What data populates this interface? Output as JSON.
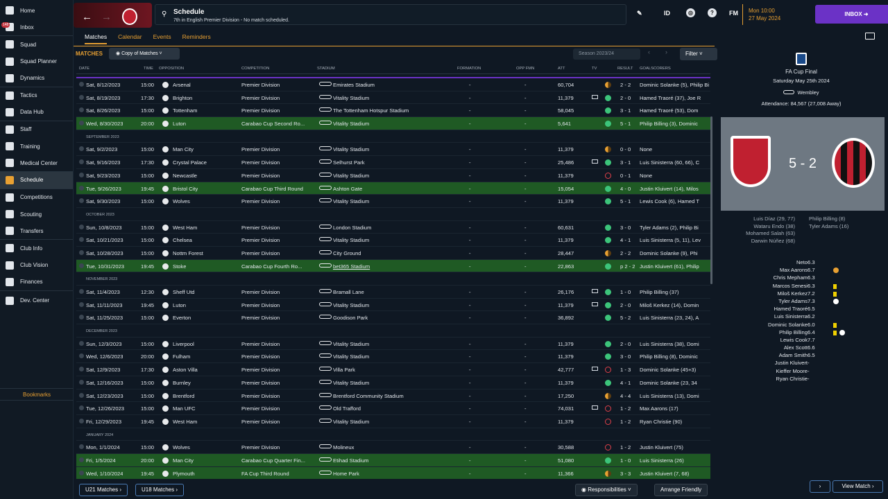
{
  "sidebar": {
    "inbox_badge": "148",
    "items": [
      "Home",
      "Inbox",
      "Squad",
      "Squad Planner",
      "Dynamics",
      "Tactics",
      "Data Hub",
      "Staff",
      "Training",
      "Medical Center",
      "Schedule",
      "Competitions",
      "Scouting",
      "Transfers",
      "Club Info",
      "Club Vision",
      "Finances",
      "Dev. Center"
    ],
    "bookmarks": "Bookmarks"
  },
  "header": {
    "title": "Schedule",
    "subtitle": "7th in English Premier Division - No match scheduled.",
    "id_label": "ID",
    "fm_label": "FM",
    "help": "?",
    "time": "Mon 10:00",
    "date": "27 May 2024",
    "inbox_label": "INBOX"
  },
  "subtabs": [
    "Matches",
    "Calendar",
    "Events",
    "Reminders"
  ],
  "toolbar": {
    "section": "MATCHES",
    "view": "Copy of Matches",
    "season": "Season 2023/24",
    "filter": "Filter"
  },
  "columns": [
    "DATE",
    "TIME",
    "OPPOSITION",
    "COMPETITION",
    "STADIUM",
    "FORMATION",
    "OPP FMN",
    "ATT",
    "TV",
    "RESULT",
    "GOALSCORERS"
  ],
  "rows": [
    {
      "date": "Sat, 8/12/2023",
      "time": "15:00",
      "opp": "Arsenal",
      "comp": "Premier Division",
      "stadium": "Emirates Stadium",
      "fmn": "-",
      "oppfmn": "-",
      "att": "60,704",
      "tv": false,
      "res": "D",
      "score": "2 - 2",
      "scorers": "Dominic Solanke (5), Philip Bi",
      "cup": false
    },
    {
      "date": "Sat, 8/19/2023",
      "time": "17:30",
      "opp": "Brighton",
      "comp": "Premier Division",
      "stadium": "Vitality Stadium",
      "fmn": "-",
      "oppfmn": "-",
      "att": "11,379",
      "tv": true,
      "res": "W",
      "score": "2 - 0",
      "scorers": "Hamed Traoré (37), Joe R",
      "cup": false
    },
    {
      "date": "Sat, 8/26/2023",
      "time": "15:00",
      "opp": "Tottenham",
      "comp": "Premier Division",
      "stadium": "The Tottenham Hotspur Stadium",
      "fmn": "-",
      "oppfmn": "-",
      "att": "58,045",
      "tv": false,
      "res": "W",
      "score": "3 - 1",
      "scorers": "Hamed Traoré (53), Dom",
      "cup": false
    },
    {
      "date": "Wed, 8/30/2023",
      "time": "20:00",
      "opp": "Luton",
      "comp": "Carabao Cup Second Ro...",
      "stadium": "Vitality Stadium",
      "fmn": "-",
      "oppfmn": "-",
      "att": "5,641",
      "tv": false,
      "res": "W",
      "score": "5 - 1",
      "scorers": "Philip Billing (3), Dominic",
      "cup": true
    },
    {
      "month": "SEPTEMBER 2023"
    },
    {
      "date": "Sat, 9/2/2023",
      "time": "15:00",
      "opp": "Man City",
      "comp": "Premier Division",
      "stadium": "Vitality Stadium",
      "fmn": "-",
      "oppfmn": "-",
      "att": "11,379",
      "tv": false,
      "res": "D",
      "score": "0 - 0",
      "scorers": "None",
      "cup": false
    },
    {
      "date": "Sat, 9/16/2023",
      "time": "17:30",
      "opp": "Crystal Palace",
      "comp": "Premier Division",
      "stadium": "Selhurst Park",
      "fmn": "-",
      "oppfmn": "-",
      "att": "25,486",
      "tv": true,
      "res": "W",
      "score": "3 - 1",
      "scorers": "Luis Sinisterra (60, 66), C",
      "cup": false
    },
    {
      "date": "Sat, 9/23/2023",
      "time": "15:00",
      "opp": "Newcastle",
      "comp": "Premier Division",
      "stadium": "Vitality Stadium",
      "fmn": "-",
      "oppfmn": "-",
      "att": "11,379",
      "tv": false,
      "res": "L",
      "score": "0 - 1",
      "scorers": "None",
      "cup": false
    },
    {
      "date": "Tue, 9/26/2023",
      "time": "19:45",
      "opp": "Bristol City",
      "comp": "Carabao Cup Third Round",
      "stadium": "Ashton Gate",
      "fmn": "-",
      "oppfmn": "-",
      "att": "15,054",
      "tv": false,
      "res": "W",
      "score": "4 - 0",
      "scorers": "Justin Kluivert (14), Milos",
      "cup": true
    },
    {
      "date": "Sat, 9/30/2023",
      "time": "15:00",
      "opp": "Wolves",
      "comp": "Premier Division",
      "stadium": "Vitality Stadium",
      "fmn": "-",
      "oppfmn": "-",
      "att": "11,379",
      "tv": false,
      "res": "W",
      "score": "5 - 1",
      "scorers": "Lewis Cook (6), Hamed T",
      "cup": false
    },
    {
      "month": "OCTOBER 2023"
    },
    {
      "date": "Sun, 10/8/2023",
      "time": "15:00",
      "opp": "West Ham",
      "comp": "Premier Division",
      "stadium": "London Stadium",
      "fmn": "-",
      "oppfmn": "-",
      "att": "60,631",
      "tv": false,
      "res": "W",
      "score": "3 - 0",
      "scorers": "Tyler Adams (2), Philip Bi",
      "cup": false
    },
    {
      "date": "Sat, 10/21/2023",
      "time": "15:00",
      "opp": "Chelsea",
      "comp": "Premier Division",
      "stadium": "Vitality Stadium",
      "fmn": "-",
      "oppfmn": "-",
      "att": "11,379",
      "tv": false,
      "res": "W",
      "score": "4 - 1",
      "scorers": "Luis Sinisterra (5, 11), Lev",
      "cup": false
    },
    {
      "date": "Sat, 10/28/2023",
      "time": "15:00",
      "opp": "Nottm Forest",
      "comp": "Premier Division",
      "stadium": "City Ground",
      "fmn": "-",
      "oppfmn": "-",
      "att": "28,447",
      "tv": false,
      "res": "D",
      "score": "2 - 2",
      "scorers": "Dominic Solanke (9), Phi",
      "cup": false
    },
    {
      "date": "Tue, 10/31/2023",
      "time": "19:45",
      "opp": "Stoke",
      "comp": "Carabao Cup Fourth Ro...",
      "stadium": "bet365 Stadium",
      "fmn": "-",
      "oppfmn": "-",
      "att": "22,863",
      "tv": false,
      "res": "W",
      "score": "p 2 - 2",
      "scorers": "Justin Kluivert (61), Philip",
      "cup": true
    },
    {
      "month": "NOVEMBER 2023"
    },
    {
      "date": "Sat, 11/4/2023",
      "time": "12:30",
      "opp": "Sheff Utd",
      "comp": "Premier Division",
      "stadium": "Bramall Lane",
      "fmn": "-",
      "oppfmn": "-",
      "att": "26,176",
      "tv": true,
      "res": "W",
      "score": "1 - 0",
      "scorers": "Philip Billing (37)",
      "cup": false
    },
    {
      "date": "Sat, 11/11/2023",
      "time": "19:45",
      "opp": "Luton",
      "comp": "Premier Division",
      "stadium": "Vitality Stadium",
      "fmn": "-",
      "oppfmn": "-",
      "att": "11,379",
      "tv": true,
      "res": "W",
      "score": "2 - 0",
      "scorers": "Miloš Kerkez (14), Domin",
      "cup": false
    },
    {
      "date": "Sat, 11/25/2023",
      "time": "15:00",
      "opp": "Everton",
      "comp": "Premier Division",
      "stadium": "Goodison Park",
      "fmn": "-",
      "oppfmn": "-",
      "att": "36,892",
      "tv": false,
      "res": "W",
      "score": "5 - 2",
      "scorers": "Luis Sinisterra (23, 24), A",
      "cup": false
    },
    {
      "month": "DECEMBER 2023"
    },
    {
      "date": "Sun, 12/3/2023",
      "time": "15:00",
      "opp": "Liverpool",
      "comp": "Premier Division",
      "stadium": "Vitality Stadium",
      "fmn": "-",
      "oppfmn": "-",
      "att": "11,379",
      "tv": false,
      "res": "W",
      "score": "2 - 0",
      "scorers": "Luis Sinisterra (38), Domi",
      "cup": false
    },
    {
      "date": "Wed, 12/6/2023",
      "time": "20:00",
      "opp": "Fulham",
      "comp": "Premier Division",
      "stadium": "Vitality Stadium",
      "fmn": "-",
      "oppfmn": "-",
      "att": "11,379",
      "tv": false,
      "res": "W",
      "score": "3 - 0",
      "scorers": "Philip Billing (8), Dominic",
      "cup": false
    },
    {
      "date": "Sat, 12/9/2023",
      "time": "17:30",
      "opp": "Aston Villa",
      "comp": "Premier Division",
      "stadium": "Villa Park",
      "fmn": "-",
      "oppfmn": "-",
      "att": "42,777",
      "tv": true,
      "res": "L",
      "score": "1 - 3",
      "scorers": "Dominic Solanke (45+3)",
      "cup": false
    },
    {
      "date": "Sat, 12/16/2023",
      "time": "15:00",
      "opp": "Burnley",
      "comp": "Premier Division",
      "stadium": "Vitality Stadium",
      "fmn": "-",
      "oppfmn": "-",
      "att": "11,379",
      "tv": false,
      "res": "W",
      "score": "4 - 1",
      "scorers": "Dominic Solanke (23, 34",
      "cup": false
    },
    {
      "date": "Sat, 12/23/2023",
      "time": "15:00",
      "opp": "Brentford",
      "comp": "Premier Division",
      "stadium": "Brentford Community Stadium",
      "fmn": "-",
      "oppfmn": "-",
      "att": "17,250",
      "tv": false,
      "res": "D",
      "score": "4 - 4",
      "scorers": "Luis Sinisterra (13), Domi",
      "cup": false
    },
    {
      "date": "Tue, 12/26/2023",
      "time": "15:00",
      "opp": "Man UFC",
      "comp": "Premier Division",
      "stadium": "Old Trafford",
      "fmn": "-",
      "oppfmn": "-",
      "att": "74,031",
      "tv": true,
      "res": "L",
      "score": "1 - 2",
      "scorers": "Max Aarons (17)",
      "cup": false
    },
    {
      "date": "Fri, 12/29/2023",
      "time": "19:45",
      "opp": "West Ham",
      "comp": "Premier Division",
      "stadium": "Vitality Stadium",
      "fmn": "-",
      "oppfmn": "-",
      "att": "11,379",
      "tv": false,
      "res": "L",
      "score": "1 - 2",
      "scorers": "Ryan Christie (90)",
      "cup": false
    },
    {
      "month": "JANUARY 2024"
    },
    {
      "date": "Mon, 1/1/2024",
      "time": "15:00",
      "opp": "Wolves",
      "comp": "Premier Division",
      "stadium": "Molineux",
      "fmn": "-",
      "oppfmn": "-",
      "att": "30,588",
      "tv": false,
      "res": "L",
      "score": "1 - 2",
      "scorers": "Justin Kluivert (75)",
      "cup": false
    },
    {
      "date": "Fri, 1/5/2024",
      "time": "20:00",
      "opp": "Man City",
      "comp": "Carabao Cup Quarter Fin...",
      "stadium": "Etihad Stadium",
      "fmn": "-",
      "oppfmn": "-",
      "att": "51,080",
      "tv": false,
      "res": "W",
      "score": "1 - 0",
      "scorers": "Luis Sinisterra (26)",
      "cup": true
    },
    {
      "date": "Wed, 1/10/2024",
      "time": "19:45",
      "opp": "Plymouth",
      "comp": "FA Cup Third Round",
      "stadium": "Home Park",
      "fmn": "-",
      "oppfmn": "-",
      "att": "11,366",
      "tv": false,
      "res": "D",
      "score": "3 - 3",
      "scorers": "Justin Kluivert (7, 68)",
      "cup": true
    }
  ],
  "bottom": {
    "u21": "U21 Matches",
    "u18": "U18 Matches",
    "responsibilities": "Responsibilities",
    "arrange": "Arrange Friendly"
  },
  "panel": {
    "competition": "FA Cup Final",
    "date": "Saturday May 25th 2024",
    "stadium": "Wembley",
    "attendance": "Attendance: 84,567 (27,008 Away)",
    "score": "5 - 2",
    "home_scorers": [
      "Philip Billing (8)",
      "Tyler Adams (16)"
    ],
    "away_scorers": [
      "Luis Díaz (29, 77)",
      "Wataru Endo (38)",
      "Mohamed Salah (63)",
      "Darwin Núñez (68)"
    ],
    "ratings": [
      {
        "name": "Neto",
        "val": "6.3",
        "ev": ""
      },
      {
        "name": "Max Aarons",
        "val": "6.7",
        "ev": "sub"
      },
      {
        "name": "Chris Mepham",
        "val": "6.3",
        "ev": ""
      },
      {
        "name": "Marcos Senesi",
        "val": "6.3",
        "ev": "card"
      },
      {
        "name": "Miloš Kerkez",
        "val": "7.2",
        "ev": "card"
      },
      {
        "name": "Tyler Adams",
        "val": "7.3",
        "ev": "ball"
      },
      {
        "name": "Hamed Traoré",
        "val": "6.5",
        "ev": ""
      },
      {
        "name": "Luis Sinisterra",
        "val": "6.2",
        "ev": ""
      },
      {
        "name": "Dominic Solanke",
        "val": "6.0",
        "ev": "card"
      },
      {
        "name": "Philip Billing",
        "val": "6.4",
        "ev": "card-ball"
      },
      {
        "name": "Lewis Cook",
        "val": "7.7",
        "ev": ""
      },
      {
        "name": "Alex Scott",
        "val": "6.6",
        "ev": ""
      },
      {
        "name": "Adam Smith",
        "val": "6.5",
        "ev": ""
      },
      {
        "name": "Justin Kluivert",
        "val": "-",
        "ev": ""
      },
      {
        "name": "Kieffer Moore",
        "val": "-",
        "ev": ""
      },
      {
        "name": "Ryan Christie",
        "val": "-",
        "ev": ""
      }
    ],
    "view_match": "View Match"
  }
}
